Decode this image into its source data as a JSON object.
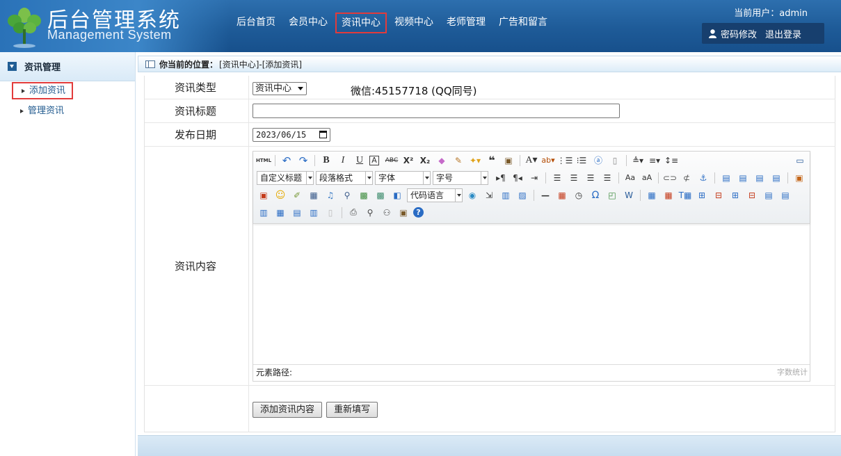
{
  "header": {
    "title": "后台管理系统",
    "subtitle": "Management System",
    "nav": [
      "后台首页",
      "会员中心",
      "资讯中心",
      "视频中心",
      "老师管理",
      "广告和留言"
    ],
    "active_nav_index": 2,
    "current_user_label": "当前用户：",
    "current_user": "admin",
    "change_password": "密码修改",
    "logout": "退出登录"
  },
  "sidebar": {
    "section": "资讯管理",
    "items": [
      {
        "label": "添加资讯",
        "active": true
      },
      {
        "label": "管理资讯",
        "active": false
      }
    ]
  },
  "breadcrumb": {
    "prefix": "你当前的位置：",
    "path": "[资讯中心]-[添加资讯]"
  },
  "form": {
    "type_label": "资讯类型",
    "type_value": "资讯中心",
    "wechat_note": "微信:45157718 (QQ同号)",
    "title_label": "资讯标题",
    "title_value": "",
    "date_label": "发布日期",
    "date_value": "2023/06/15",
    "content_label": "资讯内容",
    "submit": "添加资讯内容",
    "reset": "重新填写"
  },
  "editor": {
    "combos": {
      "custom_title": "自定义标题",
      "paragraph": "段落格式",
      "font": "字体",
      "size": "字号",
      "code_lang": "代码语言"
    },
    "path_label": "元素路径:",
    "word_count": "字数统计"
  },
  "colors": {
    "header_bg": "#1e5b98",
    "highlight": "#e23b3b",
    "link": "#225b8f"
  }
}
